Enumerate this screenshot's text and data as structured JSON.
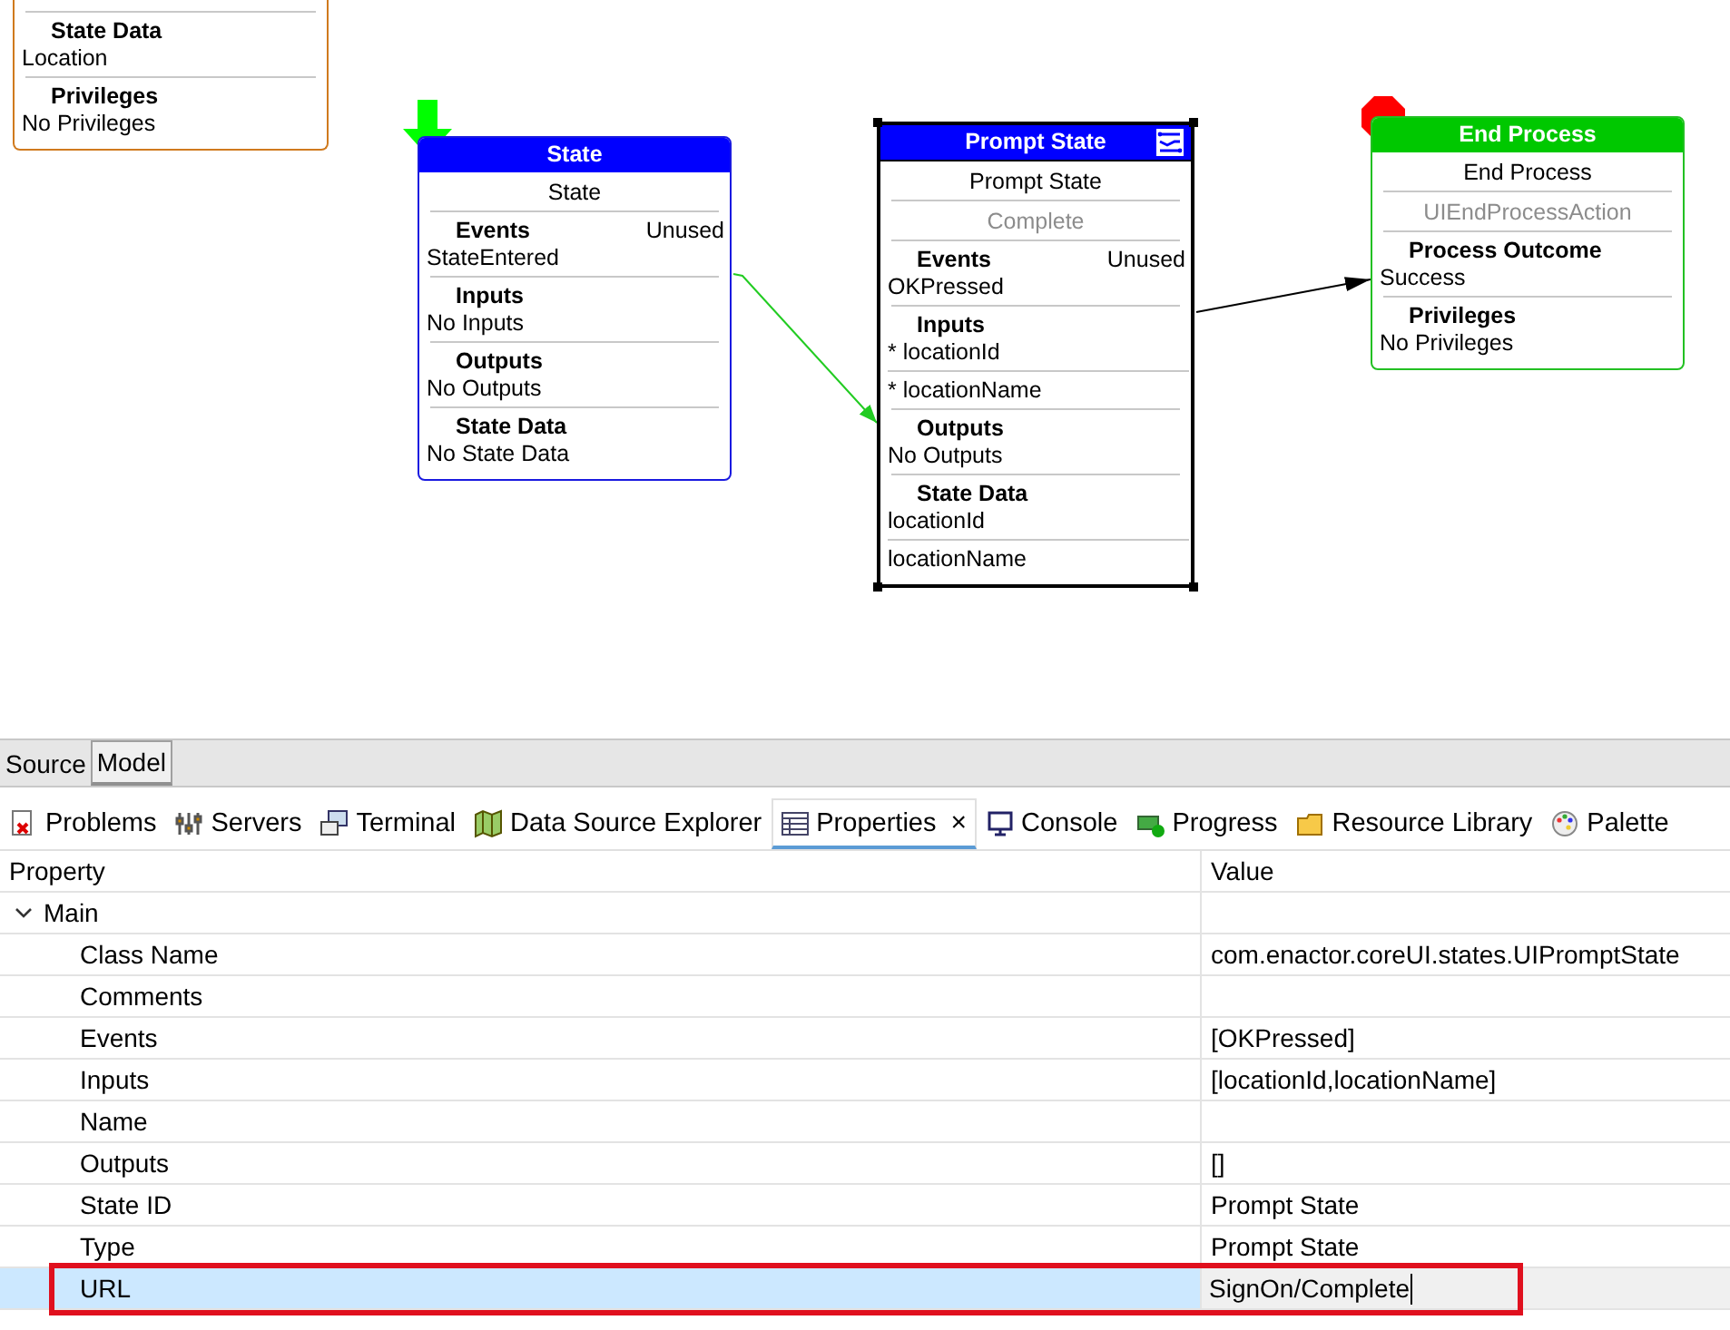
{
  "diagram": {
    "nodes": [
      {
        "kind": "partial",
        "selected": false,
        "sections": [
          {
            "heading": "State Data",
            "items": [
              "Location"
            ]
          },
          {
            "heading": "Privileges",
            "items": [
              "No Privileges"
            ]
          }
        ]
      },
      {
        "kind": "start",
        "title": "State",
        "name": "State",
        "selected": false,
        "sections": [
          {
            "heading": "Events",
            "badge": "Unused",
            "items": [
              "StateEntered"
            ]
          },
          {
            "heading": "Inputs",
            "items": [
              "No Inputs"
            ]
          },
          {
            "heading": "Outputs",
            "items": [
              "No Outputs"
            ]
          },
          {
            "heading": "State Data",
            "items": [
              "No State Data"
            ]
          }
        ]
      },
      {
        "kind": "prompt",
        "title": "Prompt State",
        "name": "Prompt State",
        "action": "Complete",
        "selected": true,
        "sections": [
          {
            "heading": "Events",
            "badge": "Unused",
            "items": [
              "OKPressed"
            ]
          },
          {
            "heading": "Inputs",
            "items": [
              "* locationId",
              "* locationName"
            ]
          },
          {
            "heading": "Outputs",
            "items": [
              "No Outputs"
            ]
          },
          {
            "heading": "State Data",
            "items": [
              "locationId",
              "locationName"
            ]
          }
        ]
      },
      {
        "kind": "end",
        "title": "End Process",
        "name": "End Process",
        "action": "UIEndProcessAction",
        "selected": false,
        "sections": [
          {
            "heading": "Process Outcome",
            "items": [
              "Success"
            ]
          },
          {
            "heading": "Privileges",
            "items": [
              "No Privileges"
            ]
          }
        ]
      }
    ]
  },
  "editor_tabs": [
    {
      "label": "Source",
      "selected": false
    },
    {
      "label": "Model",
      "selected": true
    }
  ],
  "view_tabs": [
    {
      "label": "Problems",
      "kind": "problems",
      "selected": false
    },
    {
      "label": "Servers",
      "kind": "servers",
      "selected": false
    },
    {
      "label": "Terminal",
      "kind": "terminal",
      "selected": false
    },
    {
      "label": "Data Source Explorer",
      "kind": "explorer",
      "selected": false
    },
    {
      "label": "Properties",
      "kind": "properties",
      "selected": true,
      "close": "×"
    },
    {
      "label": "Console",
      "kind": "console",
      "selected": false
    },
    {
      "label": "Progress",
      "kind": "progress",
      "selected": false
    },
    {
      "label": "Resource Library",
      "kind": "library",
      "selected": false
    },
    {
      "label": "Palette",
      "kind": "palette",
      "selected": false
    }
  ],
  "properties": {
    "columns": [
      "Property",
      "Value"
    ],
    "groups": [
      {
        "label": "Main",
        "expanded": true,
        "rows": [
          {
            "property": "Class Name",
            "value": "com.enactor.coreUI.states.UIPromptState",
            "selected": false
          },
          {
            "property": "Comments",
            "value": "",
            "selected": false
          },
          {
            "property": "Events",
            "value": "[OKPressed]",
            "selected": false
          },
          {
            "property": "Inputs",
            "value": "[locationId,locationName]",
            "selected": false
          },
          {
            "property": "Name",
            "value": "",
            "selected": false
          },
          {
            "property": "Outputs",
            "value": "[]",
            "selected": false
          },
          {
            "property": "State ID",
            "value": "Prompt State",
            "selected": false
          },
          {
            "property": "Type",
            "value": "Prompt State",
            "selected": false
          },
          {
            "property": "URL",
            "value": "SignOn/Complete",
            "selected": true
          }
        ]
      }
    ]
  }
}
